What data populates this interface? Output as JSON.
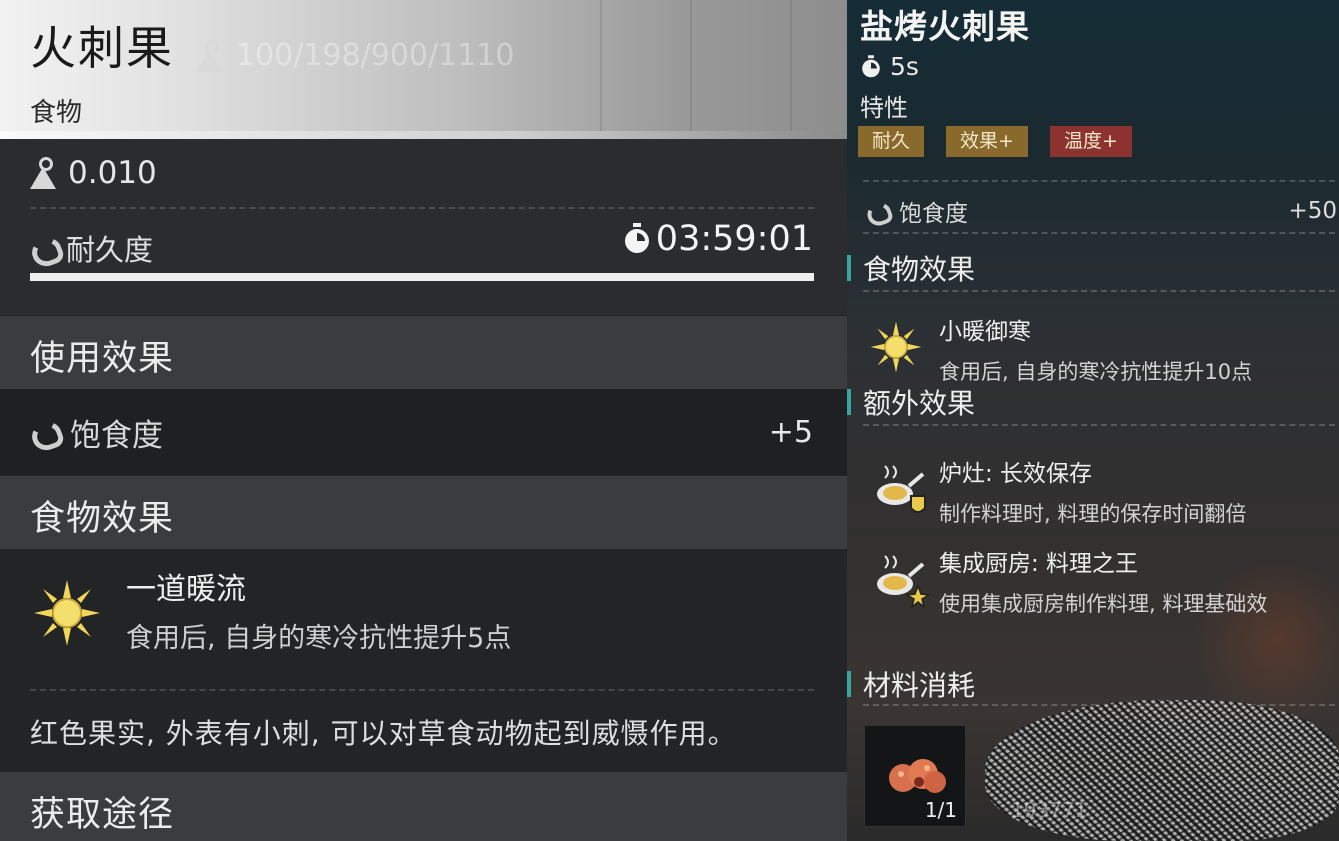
{
  "left": {
    "title": "火刺果",
    "category": "食物",
    "ghost_text": "100/198/900/1110",
    "weight": "0.010",
    "durability_label": "耐久度",
    "durability_timer": "03:59:01",
    "durability_fraction": 1.0,
    "use_effect_heading": "使用效果",
    "satiety_label": "饱食度",
    "satiety_value": "+5",
    "food_effect_heading": "食物效果",
    "food_effect": {
      "name": "一道暖流",
      "desc": "食用后, 自身的寒冷抗性提升5点",
      "icon": "sun-icon"
    },
    "description": "红色果实, 外表有小刺, 可以对草食动物起到威慑作用。",
    "obtain_heading": "获取途径"
  },
  "right": {
    "title": "盐烤火刺果",
    "cook_time": "5s",
    "traits_label": "特性",
    "tags": [
      {
        "label": "耐久",
        "color": "#8a6a2c"
      },
      {
        "label": "效果+",
        "color": "#8a6a2c"
      },
      {
        "label": "温度+",
        "color": "#8c3330"
      }
    ],
    "satiety_label": "饱食度",
    "satiety_value": "+50",
    "food_effect_heading": "食物效果",
    "food_effect": {
      "name": "小暖御寒",
      "desc": "食用后, 自身的寒冷抗性提升10点"
    },
    "extra_effect_heading": "额外效果",
    "extra_effects": [
      {
        "name": "炉灶: 长效保存",
        "desc": "制作料理时, 料理的保存时间翻倍"
      },
      {
        "name": "集成厨房: 料理之王",
        "desc": "使用集成厨房制作料理, 料理基础效"
      }
    ],
    "materials_heading": "材料消耗",
    "material_count": "1/1",
    "ghost_number": "193771"
  },
  "colors": {
    "accent_teal": "#3aa5a0",
    "sun_yellow": "#f0d65a"
  }
}
